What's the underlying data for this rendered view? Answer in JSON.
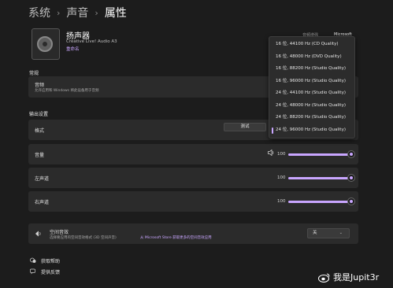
{
  "breadcrumb": {
    "items": [
      "系统",
      "声音",
      "属性"
    ],
    "separator": "›"
  },
  "device": {
    "name": "扬声器",
    "subtitle": "Creative Live! Audio A3",
    "rename_label": "重命名"
  },
  "header_small": {
    "left": "音频增强",
    "right": "Microsoft"
  },
  "general": {
    "section_label": "常规",
    "audio_title": "音频",
    "audio_desc": "允许应用和 Windows 将此设备用于音频"
  },
  "output": {
    "section_label": "输出设置",
    "format_label": "格式",
    "test_button": "测试",
    "volume_label": "音量",
    "volume_value": "100",
    "left_label": "左声道",
    "left_value": "100",
    "right_label": "右声道",
    "right_value": "100"
  },
  "format_options": [
    "16 位, 44100 Hz (CD Quality)",
    "16 位, 48000 Hz (DVD Quality)",
    "16 位, 88200 Hz (Studio Quality)",
    "16 位, 96000 Hz (Studio Quality)",
    "24 位, 44100 Hz (Studio Quality)",
    "24 位, 48000 Hz (Studio Quality)",
    "24 位, 88200 Hz (Studio Quality)",
    "24 位, 96000 Hz (Studio Quality)"
  ],
  "format_selected_index": 7,
  "spatial": {
    "title": "空间音效",
    "desc": "选择要应用的空间音效格式 (3D 空间声音)",
    "link": "从 Microsoft Store 获取更多的空间音效应用",
    "select_value": "关",
    "select_chevron": "⌄"
  },
  "footer": {
    "help": "获取帮助",
    "feedback": "提供反馈"
  },
  "watermark": {
    "text": "我是Jupit3r"
  },
  "icons": {
    "volume": "speaker-icon",
    "spatial": "spatial-audio-icon",
    "help": "help-icon",
    "feedback": "feedback-icon"
  },
  "colors": {
    "accent": "#c9a6ff",
    "background": "#1c1c1c",
    "card": "#2b2b2b"
  }
}
